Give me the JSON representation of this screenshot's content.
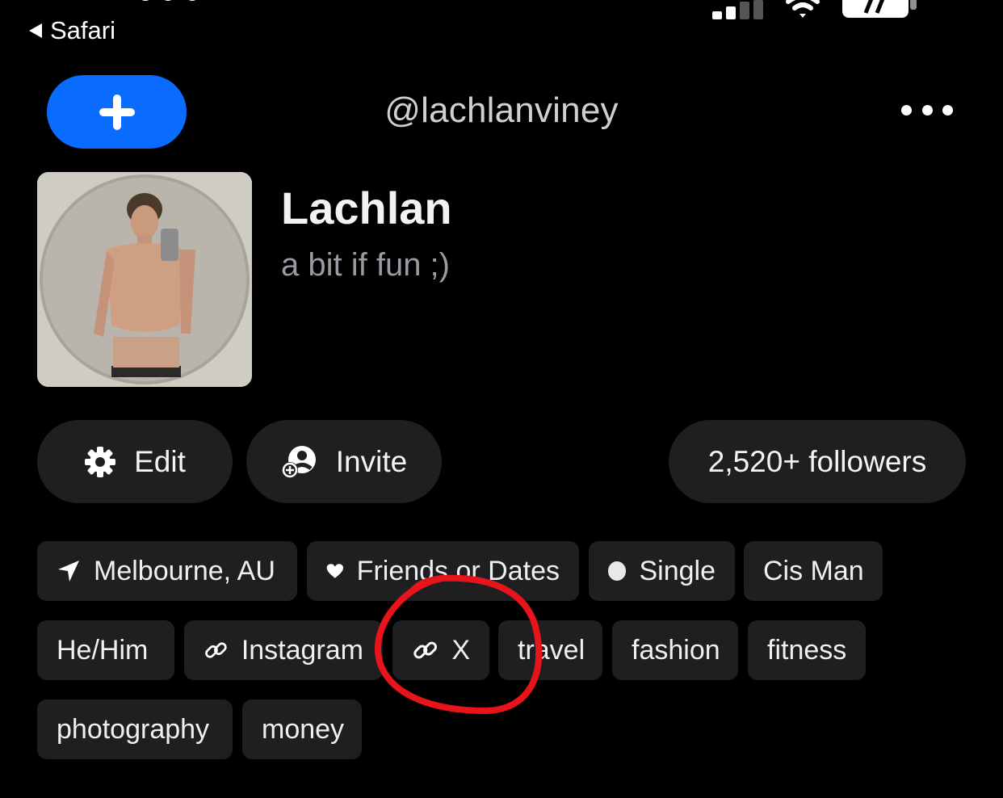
{
  "status_bar": {
    "back_label": "Safari"
  },
  "header": {
    "handle": "@lachlanviney"
  },
  "profile": {
    "display_name": "Lachlan",
    "bio": "a bit if fun ;)"
  },
  "actions": {
    "edit_label": "Edit",
    "invite_label": "Invite",
    "followers_label": "2,520+ followers"
  },
  "tags": {
    "location": "Melbourne, AU",
    "looking_for": "Friends or Dates",
    "relationship": "Single",
    "gender": "Cis Man",
    "pronouns": "He/Him",
    "link_instagram": "Instagram",
    "link_x": "X",
    "interest_travel": "travel",
    "interest_fashion": "fashion",
    "interest_fitness": "fitness",
    "interest_photography": "photography",
    "interest_money": "money"
  },
  "colors": {
    "accent": "#0a6cff",
    "annotation": "#e8141b",
    "pill_bg": "#1f1f22"
  }
}
